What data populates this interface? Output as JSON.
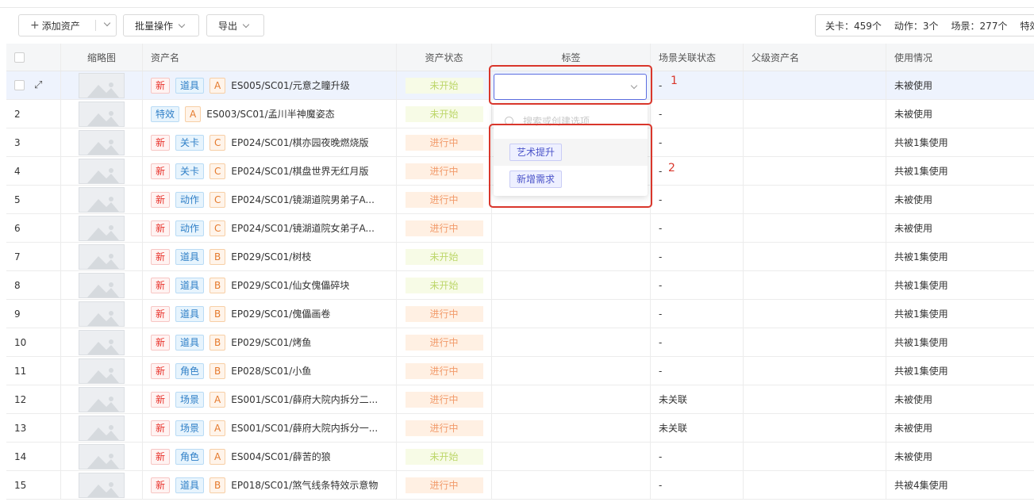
{
  "toolbar": {
    "add_label": "添加资产",
    "batch_label": "批量操作",
    "export_label": "导出",
    "stats": [
      "关卡：459个",
      "动作：3个",
      "场景：277个",
      "特效"
    ]
  },
  "table": {
    "headers": [
      "缩略图",
      "资产名",
      "资产状态",
      "标签",
      "场景关联状态",
      "父级资产名",
      "使用情况"
    ],
    "rows": [
      {
        "index": "",
        "new": "新",
        "type": "道具",
        "grade": "A",
        "name": "ES005/SC01/元意之瞳升级",
        "status": "未开始",
        "scene": "-",
        "usage": "未被使用"
      },
      {
        "index": "2",
        "new": "",
        "type": "特效",
        "grade": "A",
        "name": "ES003/SC01/孟川半神魔姿态",
        "status": "未开始",
        "scene": "-",
        "usage": "未被使用"
      },
      {
        "index": "3",
        "new": "新",
        "type": "关卡",
        "grade": "C",
        "name": "EP024/SC01/棋亦园夜晚燃烧版",
        "status": "进行中",
        "scene": "-",
        "usage": "共被1集使用"
      },
      {
        "index": "4",
        "new": "新",
        "type": "关卡",
        "grade": "C",
        "name": "EP024/SC01/棋盘世界无红月版",
        "status": "进行中",
        "scene": "-",
        "usage": "共被1集使用"
      },
      {
        "index": "5",
        "new": "新",
        "type": "动作",
        "grade": "C",
        "name": "EP024/SC01/镜湖道院男弟子A...",
        "status": "进行中",
        "scene": "-",
        "usage": "未被使用"
      },
      {
        "index": "6",
        "new": "新",
        "type": "动作",
        "grade": "C",
        "name": "EP024/SC01/镜湖道院女弟子A...",
        "status": "进行中",
        "scene": "-",
        "usage": "未被使用"
      },
      {
        "index": "7",
        "new": "新",
        "type": "道具",
        "grade": "B",
        "name": "EP029/SC01/树枝",
        "status": "未开始",
        "scene": "-",
        "usage": "共被1集使用"
      },
      {
        "index": "8",
        "new": "新",
        "type": "道具",
        "grade": "B",
        "name": "EP029/SC01/仙女傀儡碎块",
        "status": "未开始",
        "scene": "-",
        "usage": "共被1集使用"
      },
      {
        "index": "9",
        "new": "新",
        "type": "道具",
        "grade": "B",
        "name": "EP029/SC01/傀儡画卷",
        "status": "进行中",
        "scene": "-",
        "usage": "共被1集使用"
      },
      {
        "index": "10",
        "new": "新",
        "type": "道具",
        "grade": "B",
        "name": "EP029/SC01/烤鱼",
        "status": "进行中",
        "scene": "-",
        "usage": "共被1集使用"
      },
      {
        "index": "11",
        "new": "新",
        "type": "角色",
        "grade": "B",
        "name": "EP028/SC01/小鱼",
        "status": "进行中",
        "scene": "-",
        "usage": "共被1集使用"
      },
      {
        "index": "12",
        "new": "新",
        "type": "场景",
        "grade": "A",
        "name": "ES001/SC01/薛府大院内拆分二...",
        "status": "进行中",
        "scene": "未关联",
        "usage": "未被使用"
      },
      {
        "index": "13",
        "new": "新",
        "type": "场景",
        "grade": "A",
        "name": "ES001/SC01/薛府大院内拆分一...",
        "status": "进行中",
        "scene": "未关联",
        "usage": "未被使用"
      },
      {
        "index": "14",
        "new": "新",
        "type": "角色",
        "grade": "A",
        "name": "ES004/SC01/薛苦的狼",
        "status": "未开始",
        "scene": "-",
        "usage": "未被使用"
      },
      {
        "index": "15",
        "new": "新",
        "type": "道具",
        "grade": "B",
        "name": "EP018/SC01/煞气线条特效示意物",
        "status": "进行中",
        "scene": "-",
        "usage": "共被4集使用"
      }
    ]
  },
  "dropdown": {
    "search_placeholder": "搜索或创建选项",
    "options": [
      "艺术提升",
      "新增需求"
    ]
  },
  "annotations": [
    "1",
    "2"
  ],
  "colors": {
    "accent": "#5b6de0",
    "annotation": "#d9362b",
    "status_todo": "#bdd76b",
    "status_doing": "#f29b6b"
  }
}
